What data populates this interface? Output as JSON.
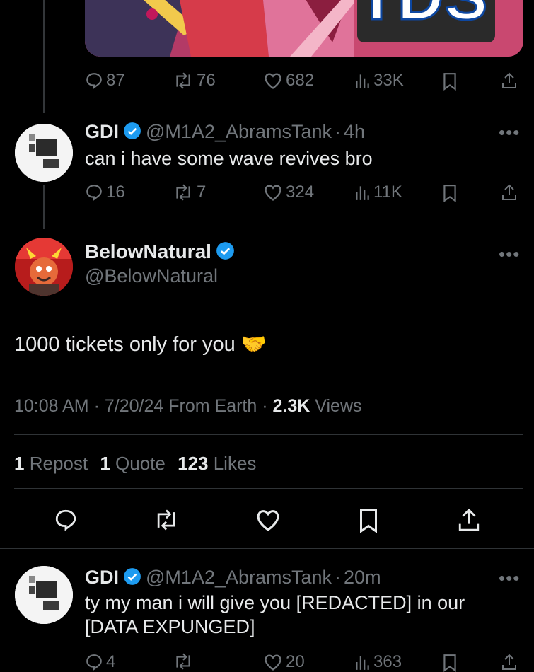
{
  "reply1_actions": {
    "replies": "87",
    "reposts": "76",
    "likes": "682",
    "views": "33K"
  },
  "reply1_media": {
    "text": "TDS"
  },
  "reply2": {
    "name": "GDI",
    "handle": "@M1A2_AbramsTank",
    "time": "4h",
    "text": "can i have some wave revives bro",
    "actions": {
      "replies": "16",
      "reposts": "7",
      "likes": "324",
      "views": "11K"
    }
  },
  "main": {
    "name": "BelowNatural",
    "handle": "@BelowNatural",
    "text": "1000 tickets only for you",
    "emoji": "🤝",
    "time": "10:08 AM",
    "date": "7/20/24",
    "source": "From Earth",
    "views_count": "2.3K",
    "views_label": "Views",
    "repost_count": "1",
    "repost_label": "Repost",
    "quote_count": "1",
    "quote_label": "Quote",
    "likes_count": "123",
    "likes_label": "Likes"
  },
  "reply3": {
    "name": "GDI",
    "handle": "@M1A2_AbramsTank",
    "time": "20m",
    "text_line1": "ty my man i will give you [REDACTED] in our",
    "text_line2": "[DATA EXPUNGED]",
    "actions": {
      "replies": "4",
      "likes": "20",
      "views": "363"
    }
  },
  "separator": "·",
  "more_glyph": "•••",
  "colors": {
    "background": "#000000",
    "text": "#e7e9ea",
    "muted": "#71767b",
    "verified": "#1d9bf0",
    "divider": "#2f3336"
  }
}
